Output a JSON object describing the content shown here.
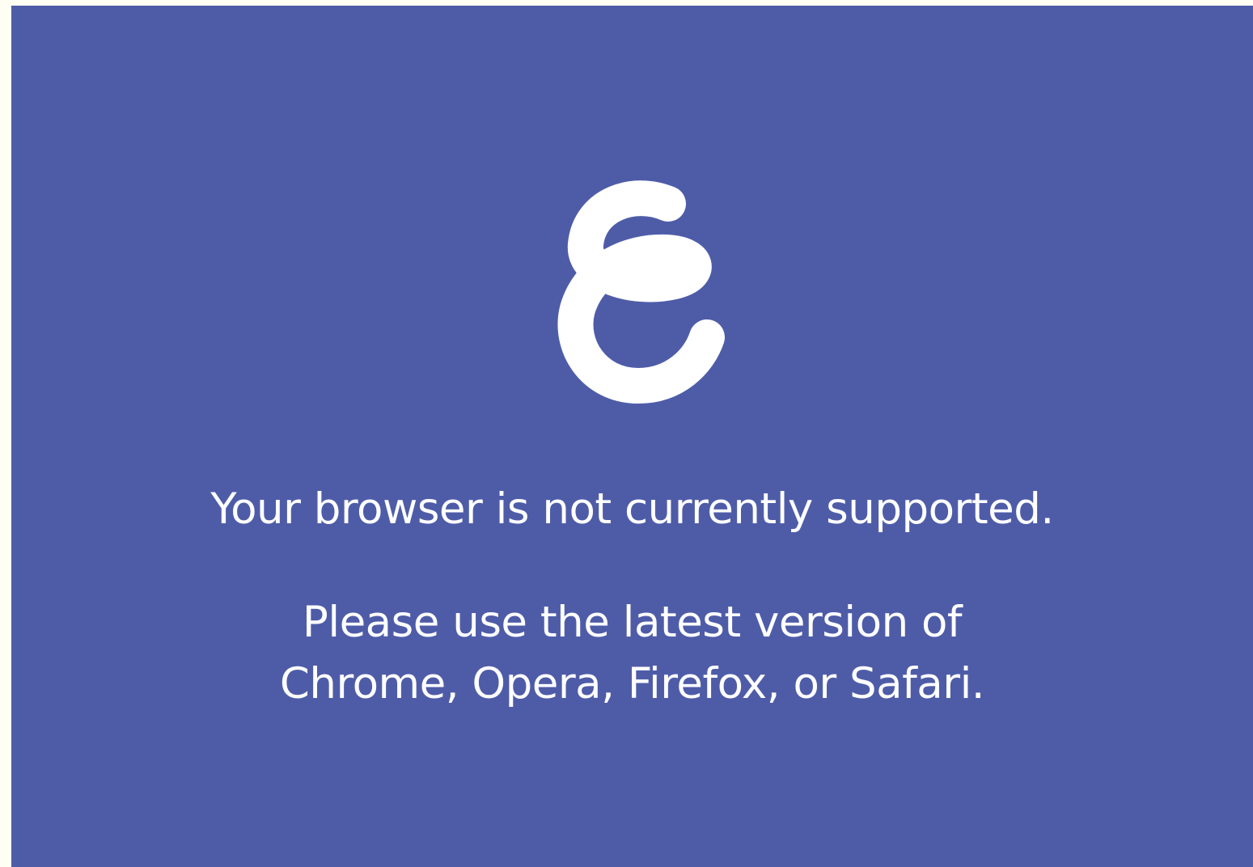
{
  "brand": {
    "logo_icon": "swirl-e-logo-icon",
    "background_color": "#4e5ca8",
    "text_color": "#ffffff",
    "outer_color": "#fffef2"
  },
  "message": {
    "headline": "Your browser is not currently supported.",
    "instruction_line1": "Please use the latest version of",
    "instruction_line2": "Chrome, Opera, Firefox, or Safari."
  }
}
